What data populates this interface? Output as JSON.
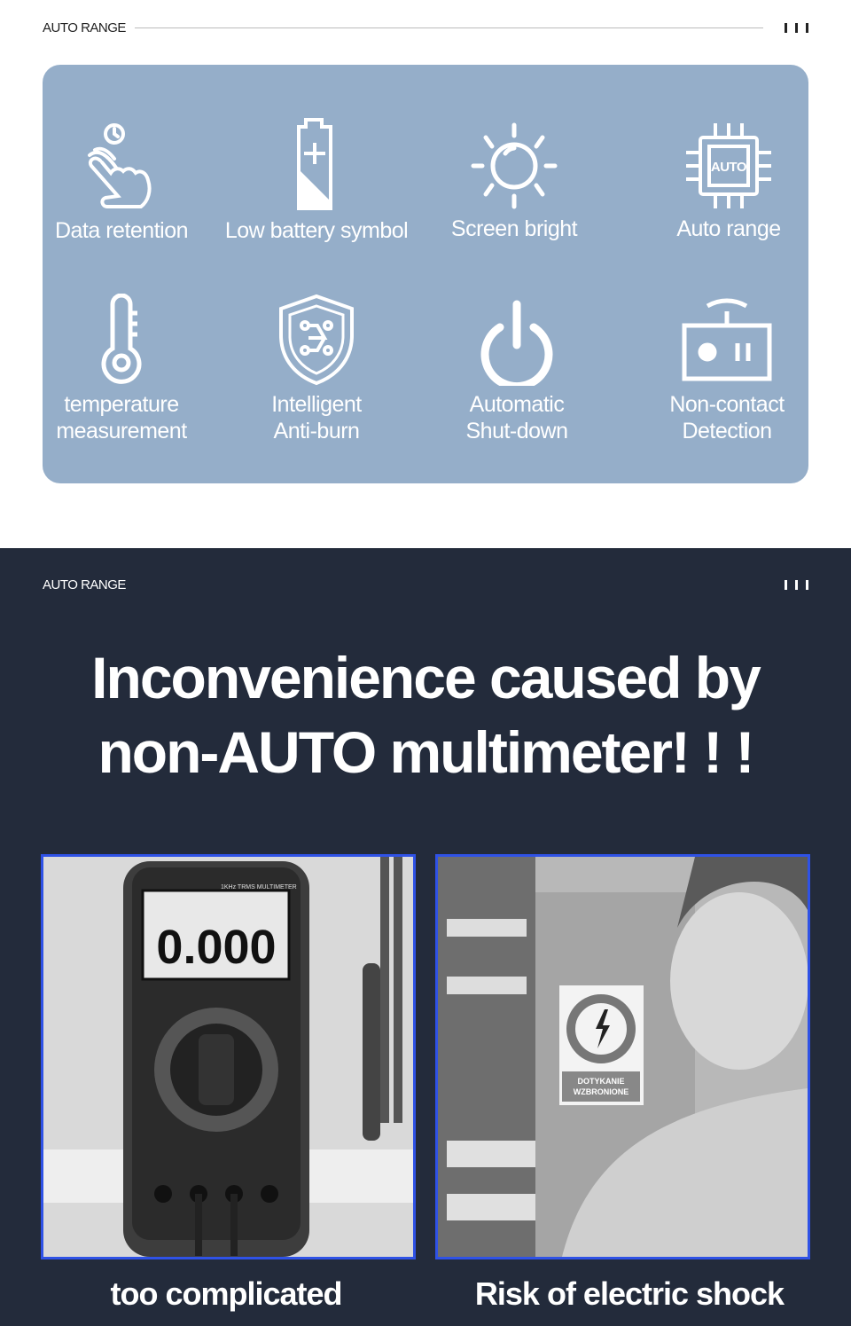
{
  "top_header": {
    "label": "AUTO RANGE"
  },
  "features": [
    {
      "icon": "touch-hand-icon",
      "label": "Data retention"
    },
    {
      "icon": "battery-icon",
      "label": "Low battery symbol"
    },
    {
      "icon": "sun-icon",
      "label": "Screen bright"
    },
    {
      "icon": "auto-chip-icon",
      "label": "Auto range",
      "icon_text": "AUTO"
    },
    {
      "icon": "thermometer-icon",
      "label_lines": [
        "temperature",
        "measurement"
      ]
    },
    {
      "icon": "shield-circuit-icon",
      "label_lines": [
        "Intelligent",
        "Anti-burn"
      ]
    },
    {
      "icon": "power-icon",
      "label_lines": [
        "Automatic",
        "Shut-down"
      ]
    },
    {
      "icon": "ncv-detector-icon",
      "label_lines": [
        "Non-contact",
        "Detection"
      ]
    }
  ],
  "bottom_header": {
    "label": "AUTO RANGE"
  },
  "headline": {
    "line1": "Inconvenience caused by",
    "line2": "non-AUTO multimeter! ! !"
  },
  "photos": [
    {
      "caption": "too complicated",
      "display": "0.000",
      "brand": "1KHz TRMS MULTIMETER"
    },
    {
      "caption": "Risk of electric shock",
      "sign_text": [
        "DOTYKANIE",
        "WZBRONIONE"
      ]
    }
  ],
  "colors": {
    "panel": "#95aec9",
    "dark": "#232b3b",
    "photo_border": "#2f52e6"
  }
}
